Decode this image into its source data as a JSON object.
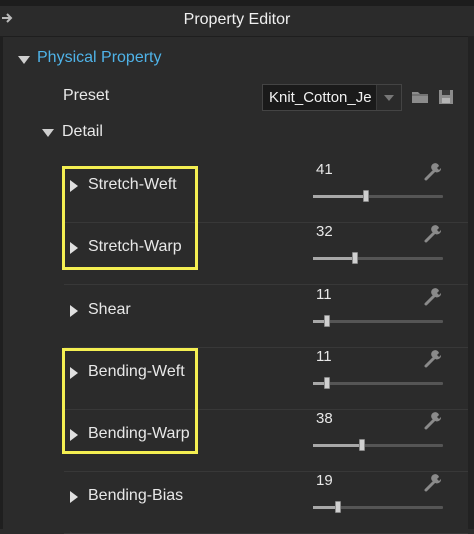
{
  "window": {
    "title": "Property Editor"
  },
  "section": {
    "label": "Physical Property"
  },
  "preset": {
    "label": "Preset",
    "value": "Knit_Cotton_Je"
  },
  "detail": {
    "label": "Detail"
  },
  "properties": [
    {
      "label": "Stretch-Weft",
      "value": 41,
      "level": 0.41
    },
    {
      "label": "Stretch-Warp",
      "value": 32,
      "level": 0.32
    },
    {
      "label": "Shear",
      "value": 11,
      "level": 0.11
    },
    {
      "label": "Bending-Weft",
      "value": 11,
      "level": 0.11
    },
    {
      "label": "Bending-Warp",
      "value": 38,
      "level": 0.38
    },
    {
      "label": "Bending-Bias",
      "value": 19,
      "level": 0.19
    }
  ],
  "colors": {
    "accent": "#4fb3e8",
    "highlight": "#f4ef52",
    "background": "#2b2b2b"
  },
  "icons": [
    "pin-icon",
    "expand-icon",
    "collapse-icon",
    "folder-icon",
    "save-icon",
    "wrench-icon"
  ]
}
